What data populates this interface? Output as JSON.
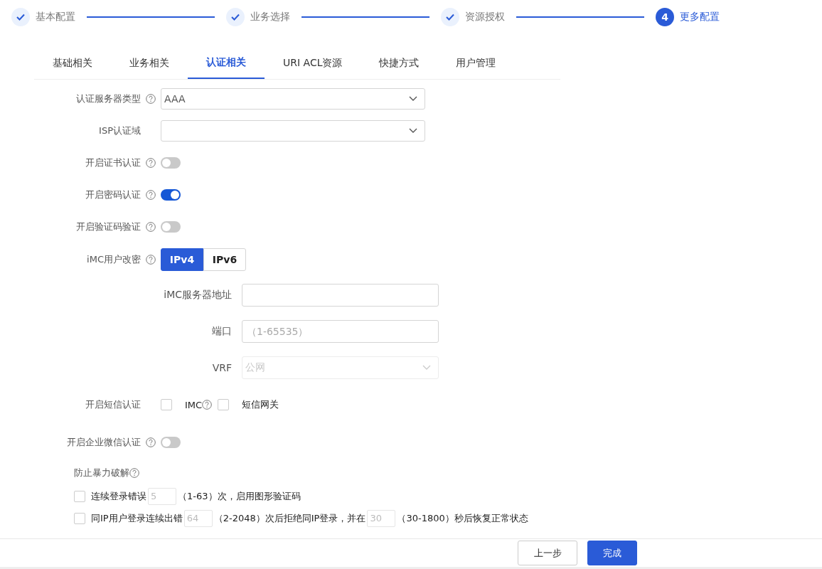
{
  "steps": [
    {
      "kind": "done",
      "label": "基本配置"
    },
    {
      "kind": "done",
      "label": "业务选择"
    },
    {
      "kind": "done",
      "label": "资源授权"
    },
    {
      "kind": "current",
      "number": "4",
      "label": "更多配置"
    }
  ],
  "tabs": [
    {
      "label": "基础相关",
      "selected": false
    },
    {
      "label": "业务相关",
      "selected": false
    },
    {
      "label": "认证相关",
      "selected": true
    },
    {
      "label": "URI ACL资源",
      "selected": false
    },
    {
      "label": "快捷方式",
      "selected": false
    },
    {
      "label": "用户管理",
      "selected": false
    }
  ],
  "rows": [
    {
      "kind": "select",
      "label": "认证服务器类型",
      "help": true,
      "value": "AAA"
    },
    {
      "kind": "select",
      "label": "ISP认证域",
      "help": false
    },
    {
      "kind": "switch",
      "label": "开启证书认证",
      "help": true,
      "on": false
    },
    {
      "kind": "switch",
      "label": "开启密码认证",
      "help": true,
      "on": true
    },
    {
      "kind": "switch",
      "label": "开启验证码验证",
      "help": true,
      "on": false
    },
    {
      "kind": "segmented",
      "label": "iMC用户改密",
      "help": true,
      "options": [
        {
          "label": "IPv4",
          "selected": true
        },
        {
          "label": "IPv6",
          "selected": false
        }
      ]
    }
  ],
  "imc_settings": [
    {
      "kind": "input",
      "label": "iMC服务器地址"
    },
    {
      "kind": "input",
      "label": "端口",
      "placeholder": "（1-65535）"
    },
    {
      "kind": "select",
      "label": "VRF",
      "value": "公网",
      "disabled": true
    }
  ],
  "sms": {
    "label": "开启短信认证",
    "options": [
      {
        "label": "IMC",
        "help": true,
        "checked": false
      },
      {
        "label": "短信网关",
        "help": false,
        "checked": false
      }
    ]
  },
  "wechat": {
    "label": "开启企业微信认证",
    "help": true,
    "on": false
  },
  "brute_force": {
    "title": "防止暴力破解",
    "help": true,
    "rules": [
      {
        "checked": false,
        "parts": [
          {
            "kind": "text",
            "text": "连续登录错误"
          },
          {
            "kind": "input",
            "placeholder": "5"
          },
          {
            "kind": "text",
            "text": "（1-63）次，启用图形验证码"
          }
        ]
      },
      {
        "checked": false,
        "parts": [
          {
            "kind": "text",
            "text": "同IP用户登录连续出错"
          },
          {
            "kind": "input",
            "placeholder": "64"
          },
          {
            "kind": "text",
            "text": "（2-2048）次后拒绝同IP登录，并在"
          },
          {
            "kind": "input",
            "placeholder": "30"
          },
          {
            "kind": "text",
            "text": "（30-1800）秒后恢复正常状态"
          }
        ]
      }
    ]
  },
  "footer_buttons": [
    {
      "kind": "secondary",
      "label": "上一步"
    },
    {
      "kind": "primary",
      "label": "完成"
    }
  ]
}
